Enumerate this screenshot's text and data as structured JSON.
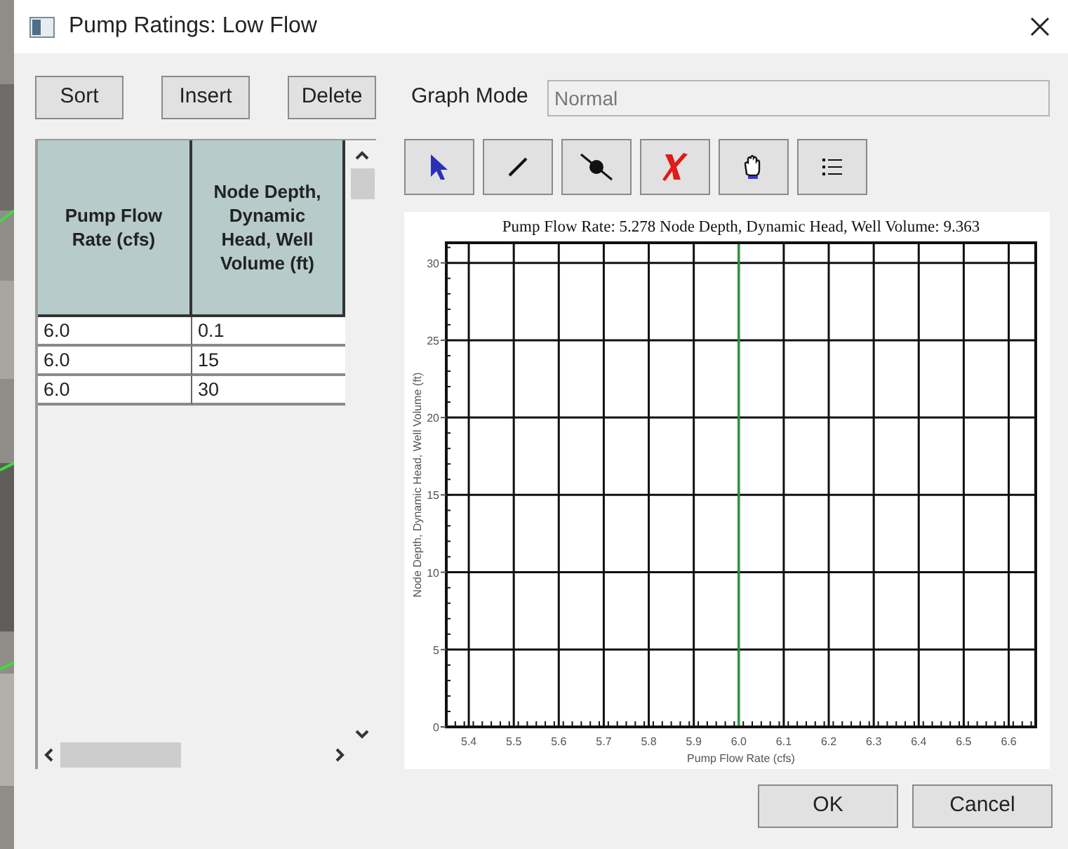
{
  "window": {
    "title": "Pump Ratings: Low Flow"
  },
  "table_buttons": [
    "Sort",
    "Insert",
    "Delete"
  ],
  "graph_mode": {
    "label": "Graph Mode",
    "value": "Normal"
  },
  "table": {
    "columns": [
      "Pump Flow Rate (cfs)",
      "Node Depth, Dynamic Head, Well Volume (ft)"
    ],
    "rows": [
      [
        "6.0",
        "0.1"
      ],
      [
        "6.0",
        "15"
      ],
      [
        "6.0",
        "30"
      ]
    ]
  },
  "tools": [
    {
      "kind": "pointer",
      "selected": false
    },
    {
      "kind": "line",
      "selected": false
    },
    {
      "kind": "point",
      "selected": false
    },
    {
      "kind": "delete",
      "selected": false
    },
    {
      "kind": "pan",
      "selected": false
    },
    {
      "kind": "list",
      "selected": false
    }
  ],
  "chart": {
    "chart_data": {
      "type": "line",
      "title": "Pump Flow Rate: 5.278 Node Depth, Dynamic Head, Well Volume: 9.363",
      "xlabel": "Pump Flow Rate (cfs)",
      "ylabel": "Node Depth, Dynamic Head, Well Volume (ft)",
      "grid": true,
      "ref_lines": [
        {
          "axis": "x",
          "value": 6.0,
          "color": "#2e9b3a"
        }
      ],
      "xlim": [
        5.35,
        6.66
      ],
      "ylim": [
        0,
        31.3
      ],
      "xticks": [
        {
          "value": 5.4,
          "label": "5.4"
        },
        {
          "value": 5.5,
          "label": "5.5"
        },
        {
          "value": 5.6,
          "label": "5.6"
        },
        {
          "value": 5.7,
          "label": "5.7"
        },
        {
          "value": 5.8,
          "label": "5.8"
        },
        {
          "value": 5.9,
          "label": "5.9"
        },
        {
          "value": 6.0,
          "label": "6.0"
        },
        {
          "value": 6.1,
          "label": "6.1"
        },
        {
          "value": 6.2,
          "label": "6.2"
        },
        {
          "value": 6.3,
          "label": "6.3"
        },
        {
          "value": 6.4,
          "label": "6.4"
        },
        {
          "value": 6.5,
          "label": "6.5"
        },
        {
          "value": 6.6,
          "label": "6.6"
        }
      ],
      "yticks": [
        0,
        5,
        10,
        15,
        20,
        25,
        30
      ]
    }
  },
  "dialog_buttons": [
    "OK",
    "Cancel"
  ]
}
